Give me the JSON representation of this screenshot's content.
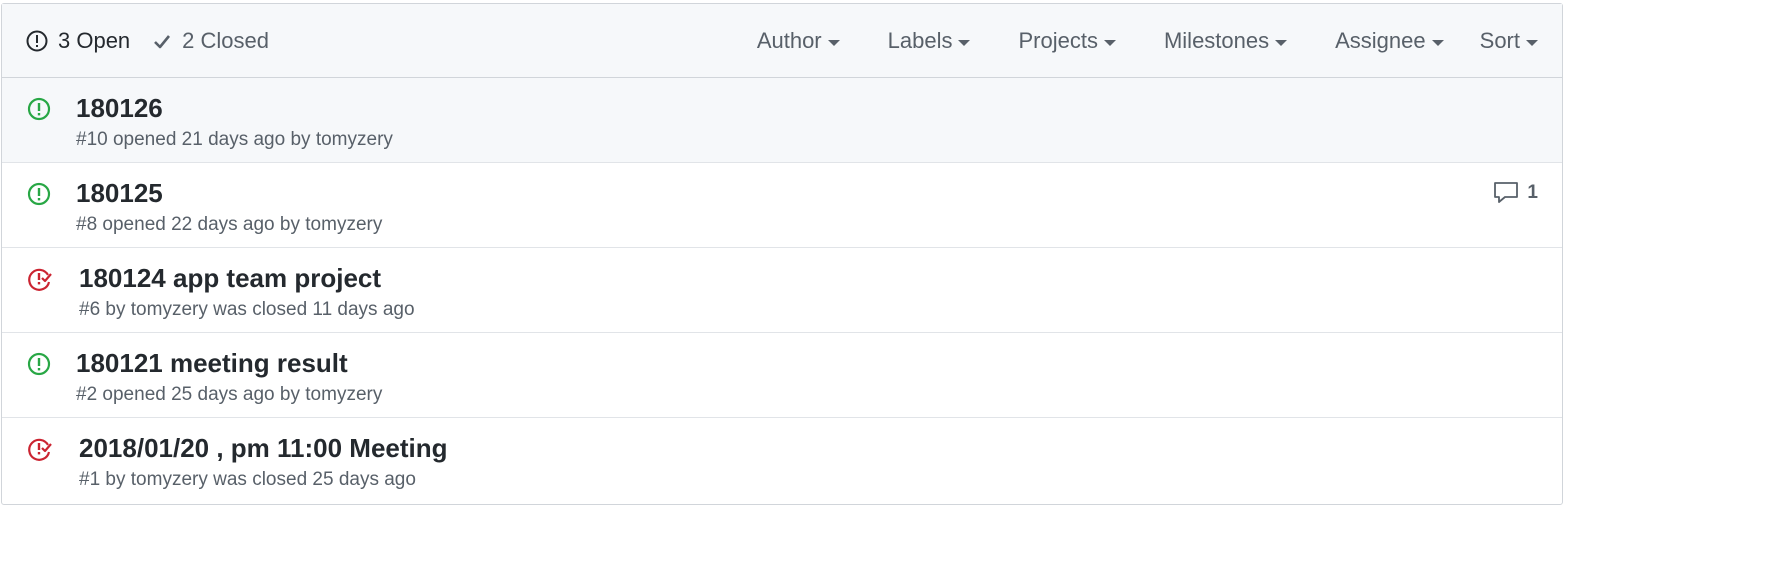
{
  "header": {
    "open_label": "3 Open",
    "closed_label": "2 Closed",
    "filters": [
      "Author",
      "Labels",
      "Projects",
      "Milestones",
      "Assignee",
      "Sort"
    ]
  },
  "colors": {
    "open": "#28a745",
    "closed": "#cb2431",
    "text": "#24292e",
    "muted": "#586069"
  },
  "issues": [
    {
      "state": "open",
      "icon": "issue-opened-icon",
      "title": "180126",
      "number": "#10",
      "status_text": "opened 21 days ago by",
      "author": "tomyzery",
      "comments": ""
    },
    {
      "state": "open",
      "icon": "issue-opened-icon",
      "title": "180125",
      "number": "#8",
      "status_text": "opened 22 days ago by",
      "author": "tomyzery",
      "comments": "1"
    },
    {
      "state": "closed",
      "icon": "issue-closed-icon",
      "title": "180124 app team project",
      "number": "#6",
      "status_text": "by",
      "author": "tomyzery",
      "closed_text": "was closed 11 days ago",
      "comments": ""
    },
    {
      "state": "open",
      "icon": "issue-opened-icon",
      "title": "180121 meeting result",
      "number": "#2",
      "status_text": "opened 25 days ago by",
      "author": "tomyzery",
      "comments": ""
    },
    {
      "state": "closed",
      "icon": "issue-closed-icon",
      "title": "2018/01/20 , pm 11:00 Meeting",
      "number": "#1",
      "status_text": "by",
      "author": "tomyzery",
      "closed_text": "was closed 25 days ago",
      "comments": ""
    }
  ]
}
